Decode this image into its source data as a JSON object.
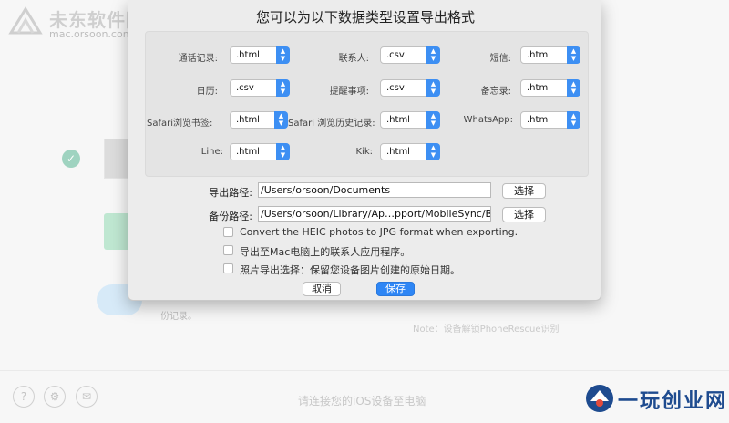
{
  "watermark": {
    "title": "未东软件园",
    "url": "mac.orsoon.com",
    "logo_icon": "orsoon-logo-icon"
  },
  "background": {
    "partial_text": "份记录。",
    "note": "Note：设备解锁PhoneRescue识别",
    "connect_prompt": "请连接您的iOS设备至电脑",
    "bottom_buttons": [
      {
        "icon": "help-icon",
        "glyph": "?"
      },
      {
        "icon": "settings-icon",
        "glyph": "⚙"
      },
      {
        "icon": "mail-icon",
        "glyph": "✉"
      }
    ],
    "brand_text": "一玩创业网",
    "brand_icon": "brand-logo-icon"
  },
  "dialog": {
    "title": "您可以为以下数据类型设置导出格式",
    "formats": [
      {
        "label": "通话记录:",
        "value": ".html"
      },
      {
        "label": "联系人:",
        "value": ".csv"
      },
      {
        "label": "短信:",
        "value": ".html"
      },
      {
        "label": "日历:",
        "value": ".csv"
      },
      {
        "label": "提醒事项:",
        "value": ".csv"
      },
      {
        "label": "备忘录:",
        "value": ".html"
      },
      {
        "label": "Safari浏览书签:",
        "value": ".html"
      },
      {
        "label": "Safari 浏览历史记录:",
        "value": ".html"
      },
      {
        "label": "WhatsApp:",
        "value": ".html"
      },
      {
        "label": "Line:",
        "value": ".html"
      },
      {
        "label": "Kik:",
        "value": ".html"
      }
    ],
    "export_path": {
      "label": "导出路径:",
      "value": "/Users/orsoon/Documents",
      "button": "选择"
    },
    "backup_path": {
      "label": "备份路径:",
      "value": "/Users/orsoon/Library/Ap…pport/MobileSync/Backup",
      "button": "选择"
    },
    "options": [
      {
        "label": "Convert the HEIC photos to JPG format when exporting.",
        "checked": false
      },
      {
        "label": "导出至Mac电脑上的联系人应用程序。",
        "checked": false
      },
      {
        "label": "照片导出选择：保留您设备图片创建的原始日期。",
        "checked": false
      }
    ],
    "cancel_label": "取消",
    "save_label": "保存",
    "accent_color": "#2e86f5"
  }
}
